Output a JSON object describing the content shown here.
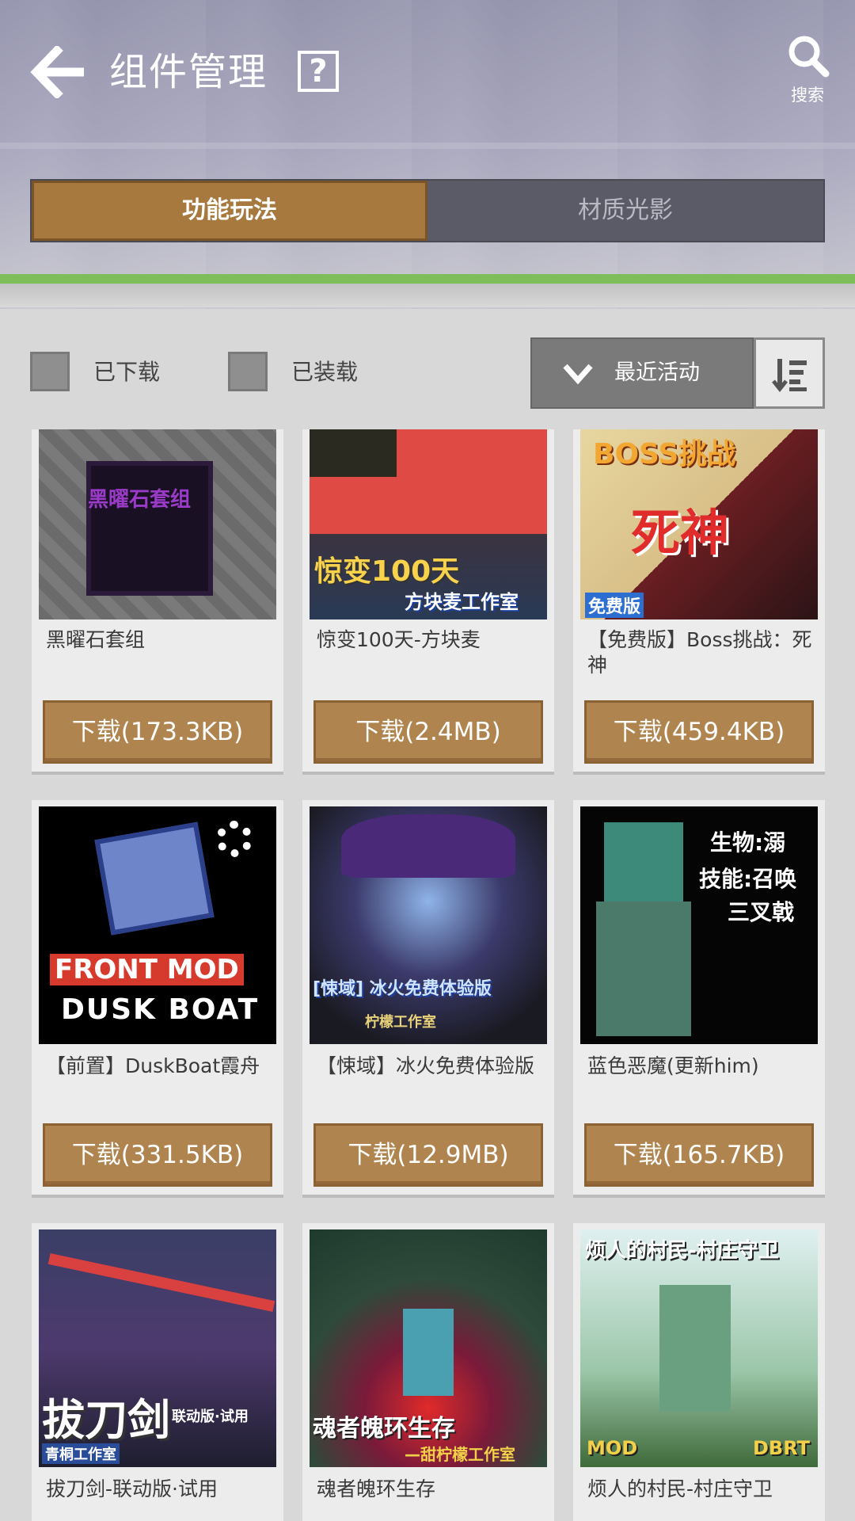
{
  "header": {
    "title": "组件管理",
    "help_symbol": "?",
    "search_label": "搜索"
  },
  "tabs": [
    {
      "label": "功能玩法",
      "active": true
    },
    {
      "label": "材质光影",
      "active": false
    }
  ],
  "filters": {
    "downloaded_label": "已下载",
    "installed_label": "已装载",
    "sort_selected": "最近活动"
  },
  "items": [
    {
      "title": "黑曜石套组",
      "download": "下载(173.3KB)",
      "thumb_text": [
        "黑曜石套组"
      ]
    },
    {
      "title": "惊变100天-方块麦",
      "download": "下载(2.4MB)",
      "thumb_text": [
        "惊变100天",
        "方块麦工作室"
      ]
    },
    {
      "title": "【免费版】Boss挑战：死神",
      "download": "下载(459.4KB)",
      "thumb_text": [
        "BOSS挑战",
        "死神",
        "免费版"
      ]
    },
    {
      "title": "【前置】DuskBoat霞舟",
      "download": "下载(331.5KB)",
      "thumb_text": [
        "FRONT MOD",
        "DUSK BOAT"
      ]
    },
    {
      "title": "【悚域】冰火免费体验版",
      "download": "下载(12.9MB)",
      "thumb_text": [
        "[悚域] 冰火免费体验版",
        "柠檬工作室"
      ]
    },
    {
      "title": "蓝色恶魔(更新him)",
      "download": "下载(165.7KB)",
      "thumb_text": [
        "生物:溺",
        "技能:召唤",
        "三叉戟"
      ]
    },
    {
      "title": "拔刀剑-联动版·试用",
      "download": "",
      "thumb_text": [
        "拔刀剑",
        "联动版·试用",
        "青桐工作室"
      ]
    },
    {
      "title": "魂者魄环生存",
      "download": "",
      "thumb_text": [
        "魂者魄环生存",
        "—甜柠檬工作室"
      ]
    },
    {
      "title": "烦人的村民-村庄守卫",
      "download": "",
      "thumb_text": [
        "烦人的村民-村庄守卫",
        "MOD",
        "DBRT"
      ]
    }
  ],
  "colors": {
    "accent_brown": "#b0844f",
    "tab_active": "#a8793f",
    "green_bar": "#7fbd5a"
  }
}
